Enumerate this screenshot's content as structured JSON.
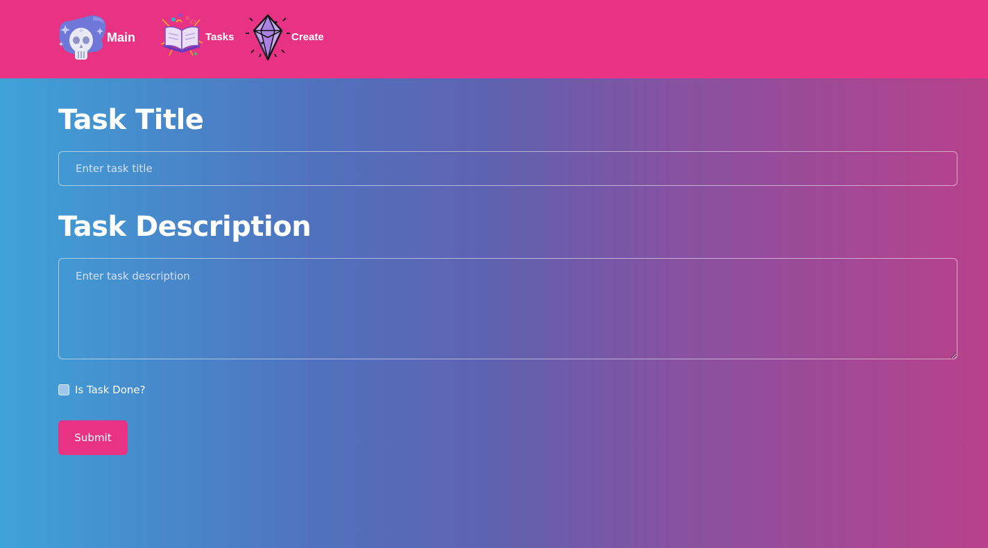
{
  "nav": {
    "main": {
      "label": "Main",
      "icon": "skull-icon"
    },
    "tasks": {
      "label": "Tasks",
      "icon": "spellbook-icon"
    },
    "create": {
      "label": "Create",
      "icon": "crystal-icon"
    }
  },
  "form": {
    "title_heading": "Task Title",
    "title_placeholder": "Enter task title",
    "title_value": "",
    "description_heading": "Task Description",
    "description_placeholder": "Enter task description",
    "description_value": "",
    "done_label": "Is Task Done?",
    "done_checked": false,
    "submit_label": "Submit"
  },
  "colors": {
    "navbar": "#e83385",
    "accent": "#e83385",
    "gradient_start": "#3fa2d8",
    "gradient_end": "#b8408a"
  }
}
